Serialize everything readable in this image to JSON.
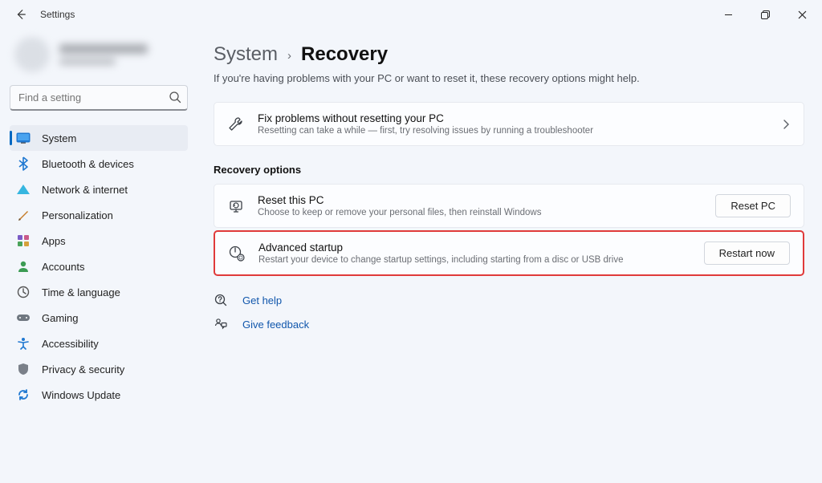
{
  "window": {
    "title": "Settings"
  },
  "search": {
    "placeholder": "Find a setting"
  },
  "nav": [
    {
      "label": "System",
      "icon": "system"
    },
    {
      "label": "Bluetooth & devices",
      "icon": "bluetooth"
    },
    {
      "label": "Network & internet",
      "icon": "network"
    },
    {
      "label": "Personalization",
      "icon": "personalization"
    },
    {
      "label": "Apps",
      "icon": "apps"
    },
    {
      "label": "Accounts",
      "icon": "accounts"
    },
    {
      "label": "Time & language",
      "icon": "time"
    },
    {
      "label": "Gaming",
      "icon": "gaming"
    },
    {
      "label": "Accessibility",
      "icon": "accessibility"
    },
    {
      "label": "Privacy & security",
      "icon": "privacy"
    },
    {
      "label": "Windows Update",
      "icon": "update"
    }
  ],
  "breadcrumb": {
    "parent": "System",
    "current": "Recovery"
  },
  "subtitle": "If you're having problems with your PC or want to reset it, these recovery options might help.",
  "troubleshoot": {
    "title": "Fix problems without resetting your PC",
    "desc": "Resetting can take a while — first, try resolving issues by running a troubleshooter"
  },
  "section_title": "Recovery options",
  "reset": {
    "title": "Reset this PC",
    "desc": "Choose to keep or remove your personal files, then reinstall Windows",
    "button": "Reset PC"
  },
  "advanced": {
    "title": "Advanced startup",
    "desc": "Restart your device to change startup settings, including starting from a disc or USB drive",
    "button": "Restart now"
  },
  "links": {
    "help": "Get help",
    "feedback": "Give feedback"
  }
}
